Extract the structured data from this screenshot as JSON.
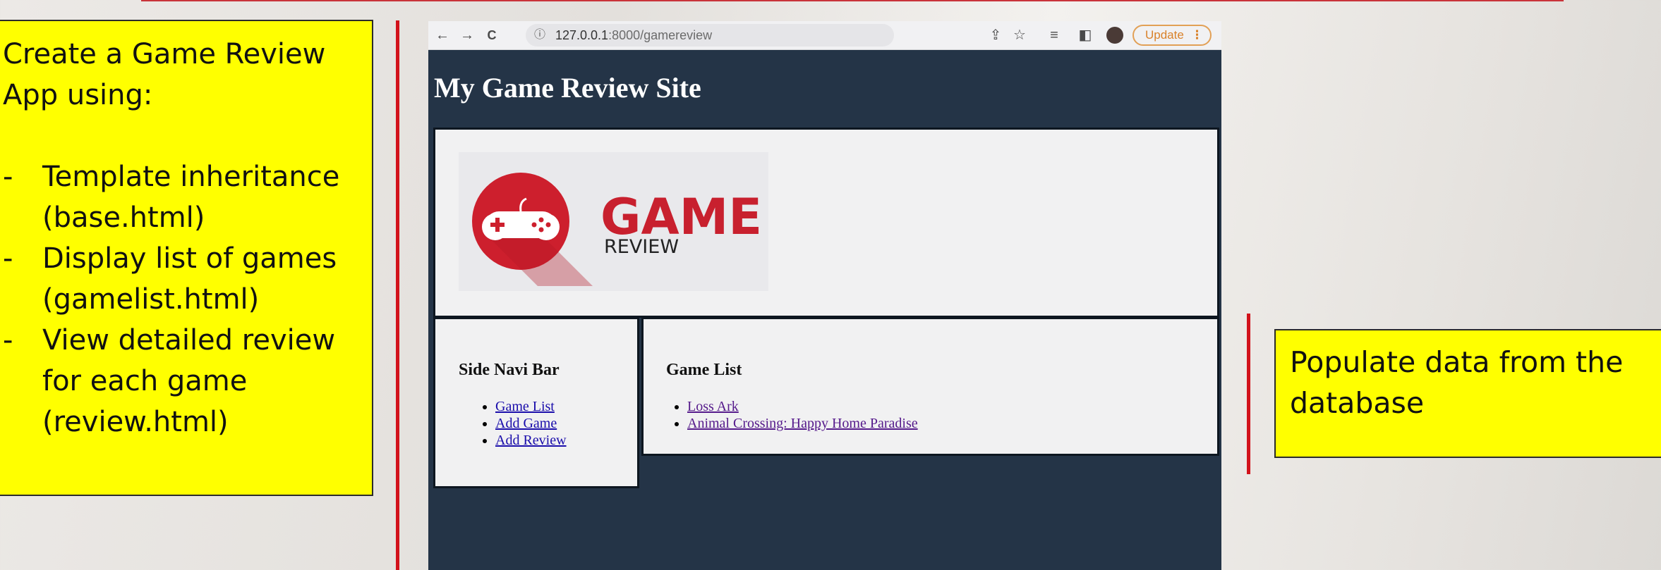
{
  "slide": {
    "left_note": {
      "title": "Create a Game Review App using:",
      "items": [
        {
          "dash": "-",
          "text": "Template inheritance (base.html)"
        },
        {
          "dash": "-",
          "text": "Display list of games (gamelist.html)"
        },
        {
          "dash": "-",
          "text": "View detailed review for each game (review.html)"
        }
      ]
    },
    "right_note": "Populate data from the database"
  },
  "browser": {
    "url_host": "127.0.0.1",
    "url_rest": ":8000/gamereview",
    "update_label": "Update",
    "icons": {
      "back": "←",
      "forward": "→",
      "reload": "C",
      "info": "ⓘ",
      "share": "⇪",
      "star": "☆",
      "reading_list": "≡",
      "side_panel": "◧",
      "menu": "⋮"
    }
  },
  "site": {
    "title": "My Game Review Site",
    "logo": {
      "word": "GAME",
      "sub": "REVIEW"
    },
    "side_nav": {
      "heading": "Side Navi Bar",
      "links": [
        "Game List",
        "Add Game",
        "Add Review"
      ]
    },
    "game_list": {
      "heading": "Game List",
      "games": [
        "Loss Ark",
        "Animal Crossing: Happy Home Paradise"
      ]
    }
  },
  "colors": {
    "note_bg": "#ffff00",
    "accent_line": "#d2121b",
    "site_bg": "#243447",
    "logo_red": "#c8202e"
  }
}
